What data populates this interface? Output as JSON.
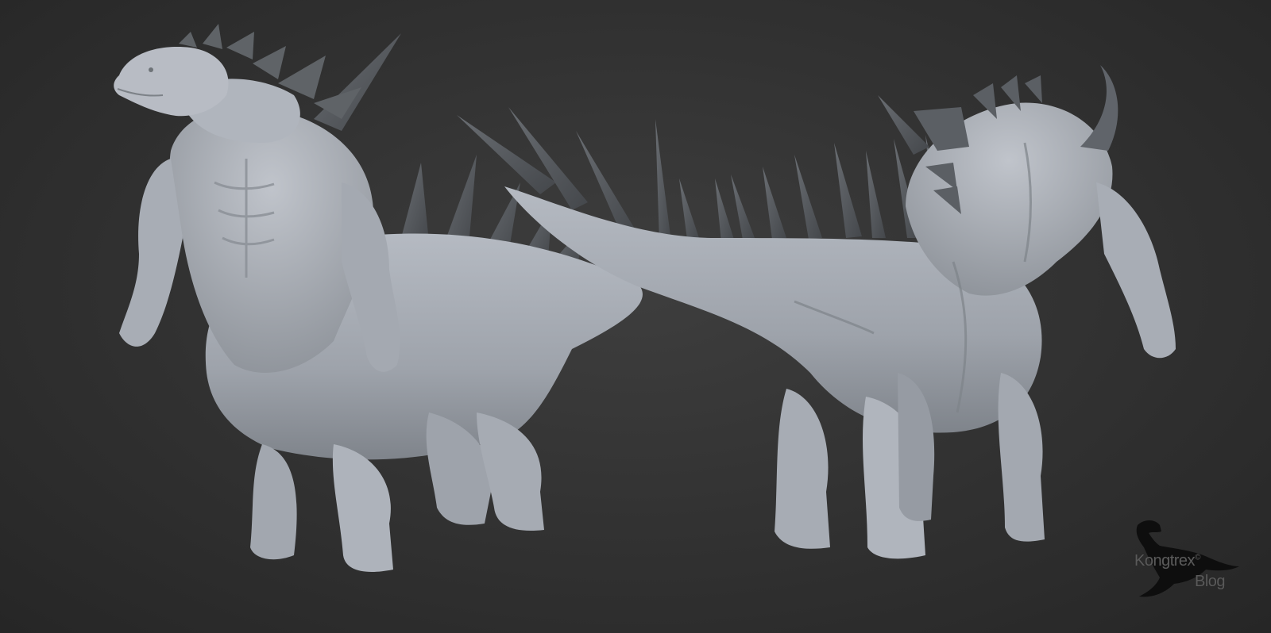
{
  "image": {
    "subject": "",
    "background_color": "#333333",
    "sculpt_color": "#a9aeb6",
    "spike_color": "#55585c"
  },
  "watermark": {
    "line1": "Kongtrex",
    "mark": "©",
    "line2": "Blog",
    "icon": "trex-silhouette-icon"
  }
}
